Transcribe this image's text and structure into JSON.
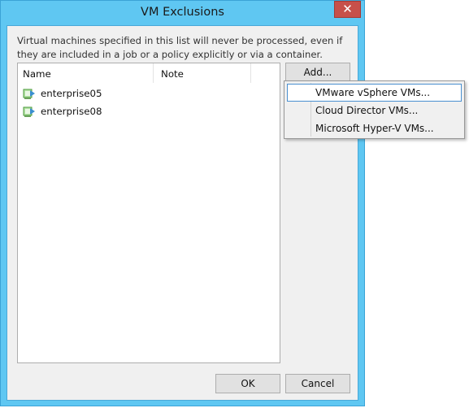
{
  "window": {
    "title": "VM Exclusions",
    "close_glyph": "✕"
  },
  "description": "Virtual machines specified in this list will never be processed, even if they are included in a job or a policy explicitly or via a container.",
  "list": {
    "columns": [
      "Name",
      "Note"
    ],
    "rows": [
      {
        "name": "enterprise05",
        "note": "",
        "icon": "vm-icon"
      },
      {
        "name": "enterprise08",
        "note": "",
        "icon": "vm-icon"
      }
    ]
  },
  "buttons": {
    "add": "Add...",
    "ok": "OK",
    "cancel": "Cancel"
  },
  "add_menu": {
    "items": [
      {
        "label": "VMware vSphere VMs...",
        "highlighted": true
      },
      {
        "label": "Cloud Director VMs...",
        "highlighted": false
      },
      {
        "label": "Microsoft Hyper-V VMs...",
        "highlighted": false
      }
    ]
  },
  "colors": {
    "frame": "#5fc7f2",
    "close": "#c7504a",
    "menu_highlight_border": "#4a90d0"
  }
}
